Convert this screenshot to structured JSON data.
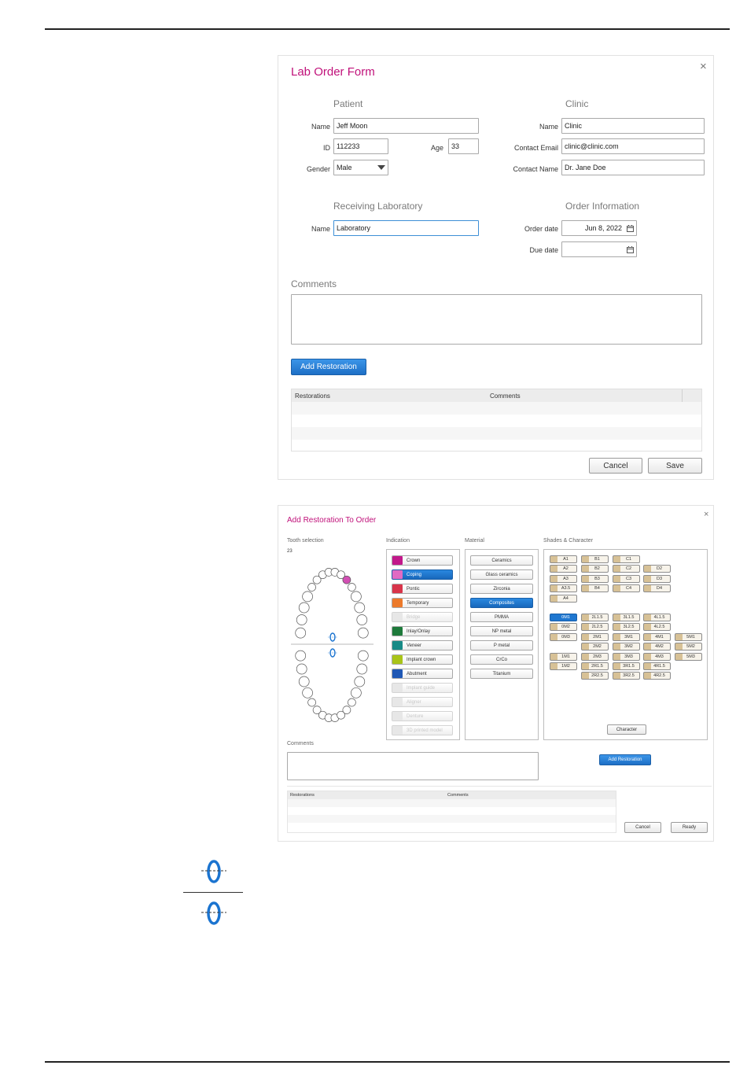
{
  "form": {
    "title": "Lab Order Form",
    "close": "×",
    "patient": {
      "heading": "Patient",
      "name_label": "Name",
      "name_value": "Jeff Moon",
      "id_label": "ID",
      "id_value": "112233",
      "age_label": "Age",
      "age_value": "33",
      "gender_label": "Gender",
      "gender_value": "Male"
    },
    "clinic": {
      "heading": "Clinic",
      "name_label": "Name",
      "name_value": "Clinic",
      "email_label": "Contact Email",
      "email_value": "clinic@clinic.com",
      "contact_label": "Contact Name",
      "contact_value": "Dr. Jane Doe"
    },
    "lab": {
      "heading": "Receiving Laboratory",
      "name_label": "Name",
      "name_value": "Laboratory"
    },
    "order": {
      "heading": "Order Information",
      "order_date_label": "Order date",
      "order_date_value": "Jun 8, 2022",
      "due_date_label": "Due date",
      "due_date_value": ""
    },
    "comments_label": "Comments",
    "add_restoration": "Add Restoration",
    "table": {
      "col1": "Restorations",
      "col2": "Comments"
    },
    "cancel": "Cancel",
    "save": "Save"
  },
  "restoration": {
    "title": "Add Restoration To Order",
    "close": "×",
    "tooth_label": "Tooth selection",
    "tooth_value": "23",
    "indication_label": "Indication",
    "material_label": "Material",
    "shades_label": "Shades & Character",
    "indications": [
      {
        "label": "Crown",
        "color": "#c2188a",
        "state": "normal"
      },
      {
        "label": "Coping",
        "color": "#e06bc3",
        "state": "selected"
      },
      {
        "label": "Pontic",
        "color": "#d8344a",
        "state": "normal"
      },
      {
        "label": "Temporary",
        "color": "#ec7a2b",
        "state": "normal"
      },
      {
        "label": "Bridge",
        "color": "#e7e7e7",
        "state": "disabled"
      },
      {
        "label": "Inlay/Onlay",
        "color": "#1e7a3b",
        "state": "normal"
      },
      {
        "label": "Veneer",
        "color": "#178a86",
        "state": "normal"
      },
      {
        "label": "Implant crown",
        "color": "#a9c418",
        "state": "normal"
      },
      {
        "label": "Abutment",
        "color": "#1f58b5",
        "state": "normal"
      },
      {
        "label": "Implant guide",
        "color": "#e7e7e7",
        "state": "disabled"
      },
      {
        "label": "Aligner",
        "color": "#e7e7e7",
        "state": "disabled"
      },
      {
        "label": "Denture",
        "color": "#e7e7e7",
        "state": "disabled"
      },
      {
        "label": "3D printed model",
        "color": "#e7e7e7",
        "state": "disabled"
      }
    ],
    "materials": [
      {
        "label": "Ceramics",
        "selected": false
      },
      {
        "label": "Glass ceramics",
        "selected": false
      },
      {
        "label": "Zirconia",
        "selected": false
      },
      {
        "label": "Composites",
        "selected": true
      },
      {
        "label": "PMMA",
        "selected": false
      },
      {
        "label": "NP metal",
        "selected": false
      },
      {
        "label": "P metal",
        "selected": false
      },
      {
        "label": "CrCo",
        "selected": false
      },
      {
        "label": "Titanium",
        "selected": false
      }
    ],
    "shades_group1": [
      [
        "A1",
        "B1",
        "C1",
        ""
      ],
      [
        "A2",
        "B2",
        "C2",
        "D2"
      ],
      [
        "A3",
        "B3",
        "C3",
        "D3"
      ],
      [
        "A3.5",
        "B4",
        "C4",
        "D4"
      ],
      [
        "A4",
        "",
        "",
        ""
      ]
    ],
    "shades_group2": [
      [
        "0M1",
        "2L1.5",
        "3L1.5",
        "4L1.5",
        ""
      ],
      [
        "0M2",
        "2L2.5",
        "3L2.5",
        "4L2.5",
        ""
      ],
      [
        "0M3",
        "2M1",
        "3M1",
        "4M1",
        "5M1"
      ],
      [
        "",
        "2M2",
        "3M2",
        "4M2",
        "5M2"
      ],
      [
        "1M1",
        "2M3",
        "3M3",
        "4M3",
        "5M3"
      ],
      [
        "1M2",
        "2R1.5",
        "3R1.5",
        "4R1.5",
        ""
      ],
      [
        "",
        "2R2.5",
        "3R2.5",
        "4R2.5",
        ""
      ]
    ],
    "selected_shade": "0M1",
    "character": "Character",
    "comments_label": "Comments",
    "add_restoration": "Add Restoration",
    "table": {
      "col1": "Restorations",
      "col2": "Comments"
    },
    "cancel": "Cancel",
    "ready": "Ready"
  },
  "colors": {
    "title": "#c0117a",
    "accent": "#1f77d0",
    "icon": "#1b74d0"
  }
}
